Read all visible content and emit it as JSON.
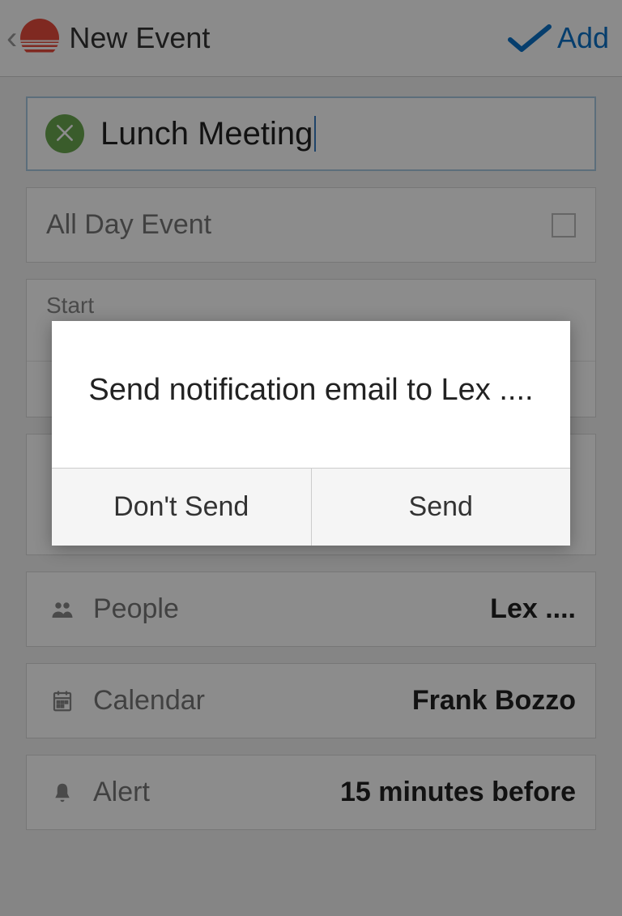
{
  "header": {
    "back_icon_name": "back-chevron-icon",
    "logo_icon_name": "sunrise-logo-icon",
    "title": "New Event",
    "add_check_icon_name": "checkmark-icon",
    "add_label": "Add"
  },
  "event": {
    "category_icon_name": "food-utensils-icon",
    "title": "Lunch Meeting"
  },
  "allday": {
    "label": "All Day Event",
    "checked": false
  },
  "times": {
    "start_label": "Start",
    "start_value": "",
    "end_label": "",
    "end_value": ""
  },
  "location": {
    "icon_name": "location-icon",
    "label": "",
    "value": ""
  },
  "people": {
    "icon_name": "people-icon",
    "label": "People",
    "value": "Lex ...."
  },
  "calendar": {
    "icon_name": "calendar-icon",
    "label": "Calendar",
    "value": "Frank Bozzo"
  },
  "alert": {
    "icon_name": "bell-icon",
    "label": "Alert",
    "value": "15 minutes before"
  },
  "dialog": {
    "message": "Send notification email to Lex ....",
    "dont_send_label": "Don't Send",
    "send_label": "Send"
  }
}
